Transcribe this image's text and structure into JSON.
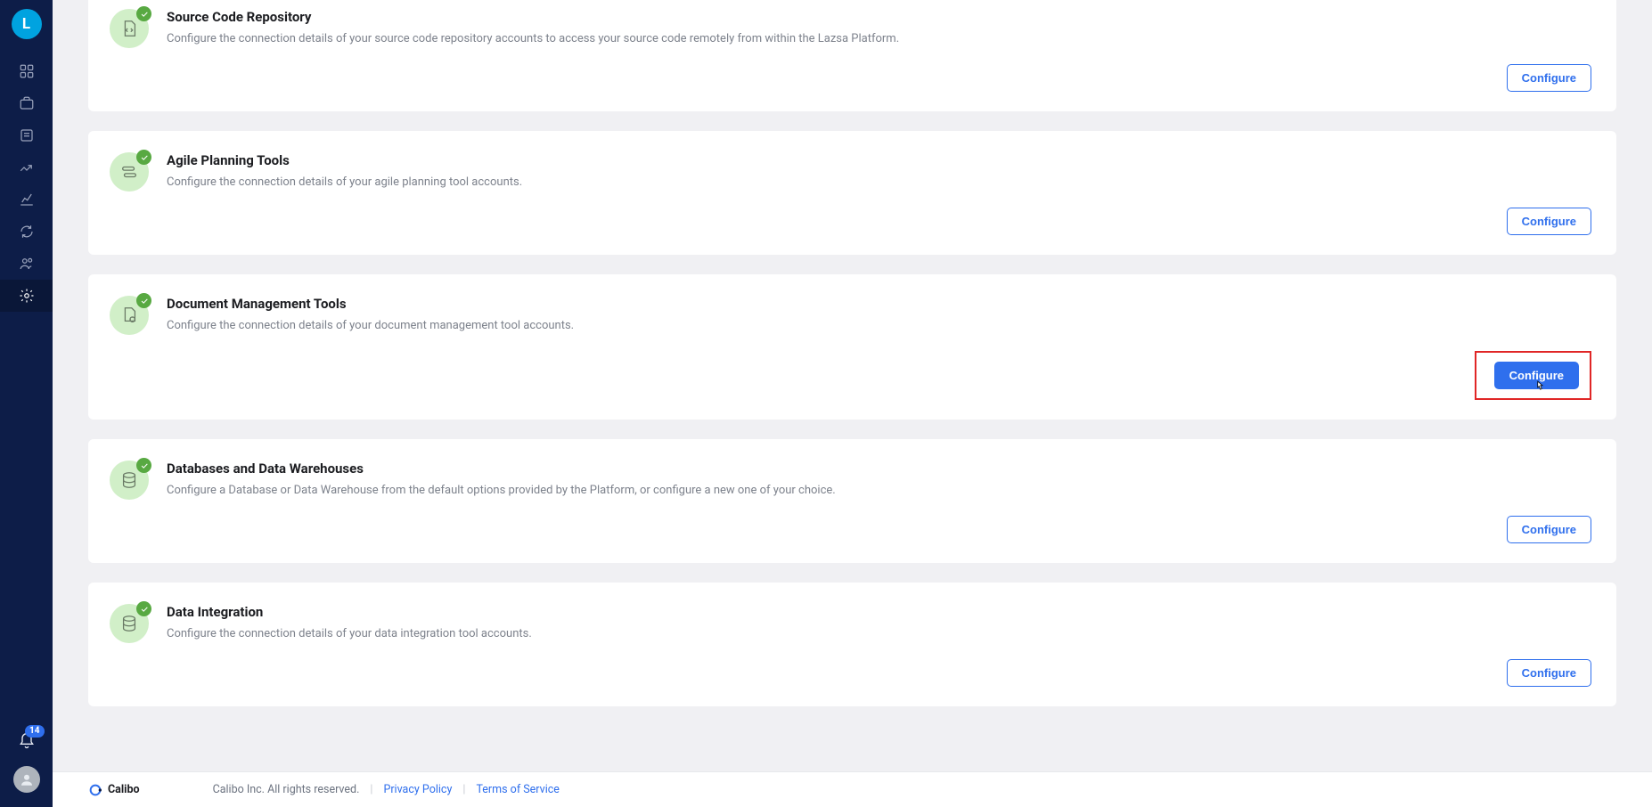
{
  "sidebar": {
    "logo_letter": "L",
    "notification_count": "14"
  },
  "cards": [
    {
      "title": "Source Code Repository",
      "desc": "Configure the connection details of your source code repository accounts to access your source code remotely from within the Lazsa Platform.",
      "button": "Configure"
    },
    {
      "title": "Agile Planning Tools",
      "desc": "Configure the connection details of your agile planning tool accounts.",
      "button": "Configure"
    },
    {
      "title": "Document Management Tools",
      "desc": "Configure the connection details of your document management tool accounts.",
      "button": "Configure"
    },
    {
      "title": "Databases and Data Warehouses",
      "desc": "Configure a Database or Data Warehouse from the default options provided by the Platform, or configure a new one of your choice.",
      "button": "Configure"
    },
    {
      "title": "Data Integration",
      "desc": "Configure the connection details of your data integration tool accounts.",
      "button": "Configure"
    }
  ],
  "footer": {
    "brand": "Calibo",
    "copyright": "Calibo Inc. All rights reserved.",
    "privacy": "Privacy Policy",
    "terms": "Terms of Service"
  }
}
